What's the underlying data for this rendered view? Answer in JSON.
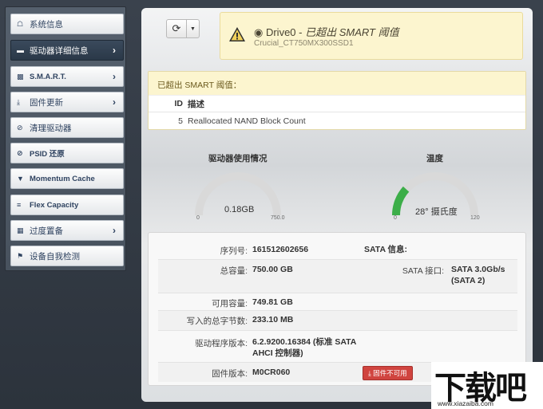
{
  "sidebar": {
    "items": [
      {
        "label": "系统信息",
        "icon": "home-icon",
        "active": false,
        "chevron": false
      },
      {
        "label": "驱动器详细信息",
        "icon": "drive-icon",
        "active": true,
        "chevron": true
      },
      {
        "label": "S.M.A.R.T.",
        "icon": "bar-chart-icon",
        "active": false,
        "chevron": true
      },
      {
        "label": "固件更新",
        "icon": "download-icon",
        "active": false,
        "chevron": true
      },
      {
        "label": "清理驱动器",
        "icon": "ban-icon",
        "active": false,
        "chevron": false
      },
      {
        "label": "PSID 还原",
        "icon": "eye-slash-icon",
        "active": false,
        "chevron": false
      },
      {
        "label": "Momentum Cache",
        "icon": "filter-icon",
        "active": false,
        "chevron": false
      },
      {
        "label": "Flex Capacity",
        "icon": "list-icon",
        "active": false,
        "chevron": false
      },
      {
        "label": "过度置备",
        "icon": "grid-icon",
        "active": false,
        "chevron": true
      },
      {
        "label": "设备自我检测",
        "icon": "flag-icon",
        "active": false,
        "chevron": false
      }
    ]
  },
  "toolbar": {
    "refresh_icon": "refresh-icon",
    "caret_icon": "caret-down-icon"
  },
  "drive": {
    "name": "Drive0",
    "separator": " - ",
    "status": "已超出 SMART 阈值",
    "model": "Crucial_CT750MX300SSD1"
  },
  "smart": {
    "heading": "已超出 SMART 阈值：",
    "col_id": "ID",
    "col_desc": "描述",
    "rows": [
      {
        "id": "5",
        "desc": "Reallocated NAND Block Count"
      }
    ]
  },
  "gauges": {
    "usage": {
      "title": "驱动器使用情况",
      "value_text": "0.18GB",
      "min": "0",
      "max": "750.0",
      "fraction": 0.0
    },
    "temp": {
      "title": "温度",
      "value_text": "28° 摄氏度",
      "min": "0",
      "max": "120",
      "fraction": 0.233
    }
  },
  "info": {
    "serial_label": "序列号:",
    "serial_value": "161512602656",
    "sata_label": "SATA 信息:",
    "capacity_label": "总容量:",
    "capacity_value": "750.00 GB",
    "sata_port_label": "SATA 接口:",
    "sata_port_value_1": "SATA 3.0Gb/s",
    "sata_port_value_2": "(SATA 2)",
    "available_label": "可用容量:",
    "available_value": "749.81 GB",
    "written_label": "写入的总字节数:",
    "written_value": "233.10 MB",
    "driver_label": "驱动程序版本:",
    "driver_value_1": "6.2.9200.16384 (标准 SATA",
    "driver_value_2": "AHCI 控制器)",
    "firmware_label": "固件版本:",
    "firmware_value": "M0CR060",
    "firmware_badge": "固件不可用"
  },
  "watermark": {
    "text": "下载吧",
    "url": "www.xiazaiba.com"
  },
  "colors": {
    "accent_green": "#3cae49",
    "gauge_track": "#d9d9d9",
    "alert_bg": "#fcf5cf",
    "badge_red": "#d0443f"
  }
}
